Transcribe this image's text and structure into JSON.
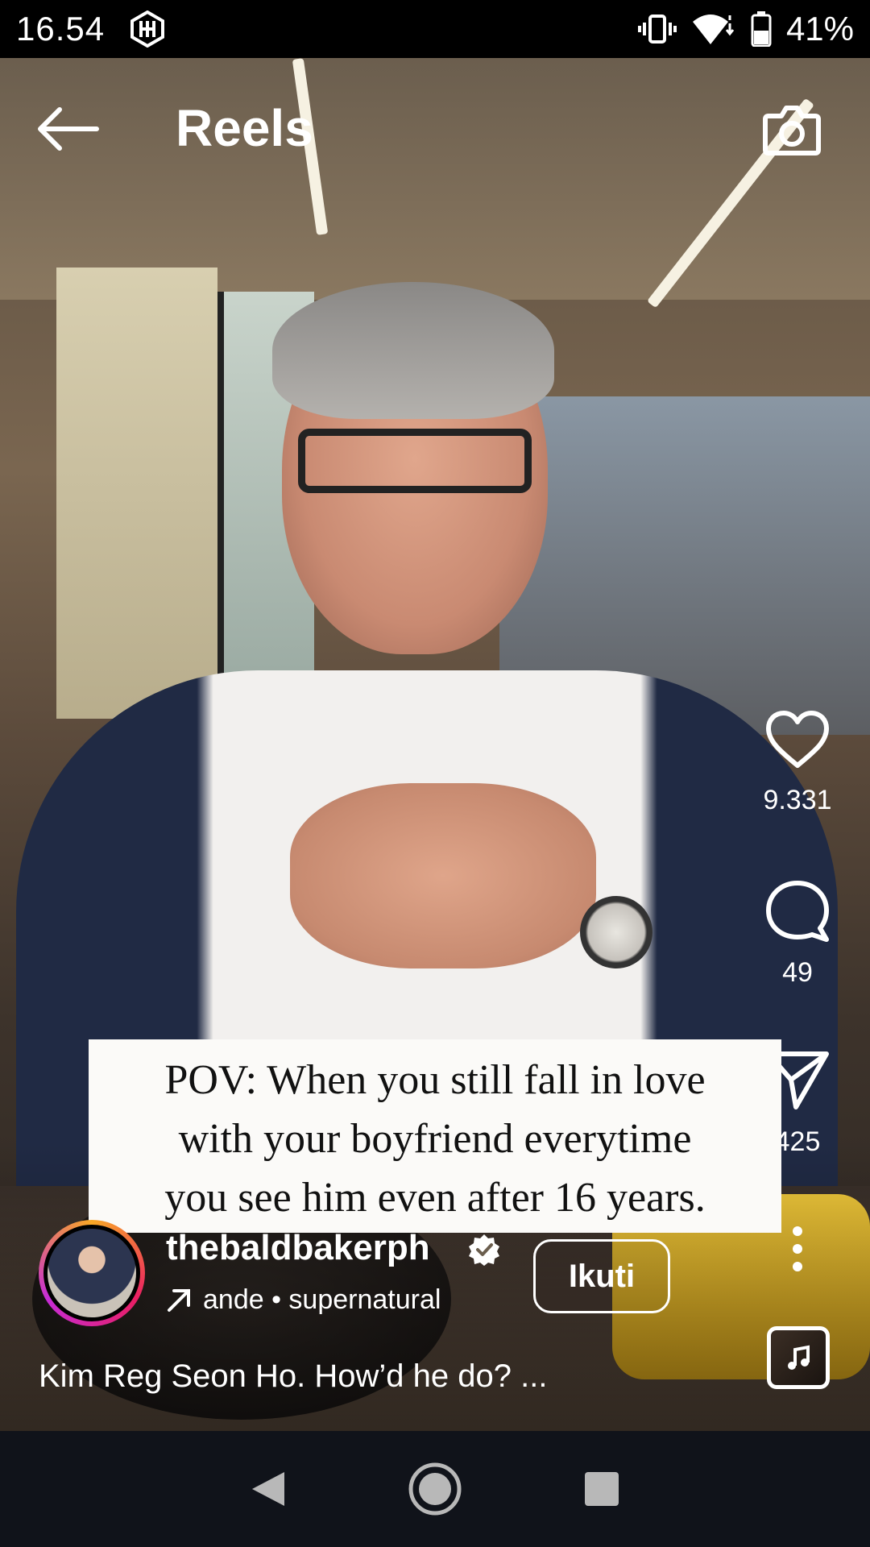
{
  "status_bar": {
    "time": "16.54",
    "battery": "41%",
    "app_icon": "hb-logo-icon",
    "icons": [
      "vibrate-icon",
      "wifi-icon",
      "battery-icon"
    ]
  },
  "header": {
    "title": "Reels",
    "back_icon": "arrow-left-icon",
    "camera_icon": "camera-icon"
  },
  "actions": {
    "likes": "9.331",
    "comments": "49",
    "shares": "425"
  },
  "overlay_text": {
    "line1": "POV: When you still fall in love",
    "line2": "with your boyfriend everytime",
    "line3": "you see him even after 16 years."
  },
  "author": {
    "username": "thebaldbakerph",
    "audio": "ande • supernatural",
    "follow_label": "Ikuti"
  },
  "caption": "Kim Reg Seon Ho. How’d he do? ...",
  "colors": {
    "accent_ring": "#e91e63",
    "nav_bg": "#10131a",
    "overlay_box": "#fbfaf8"
  }
}
